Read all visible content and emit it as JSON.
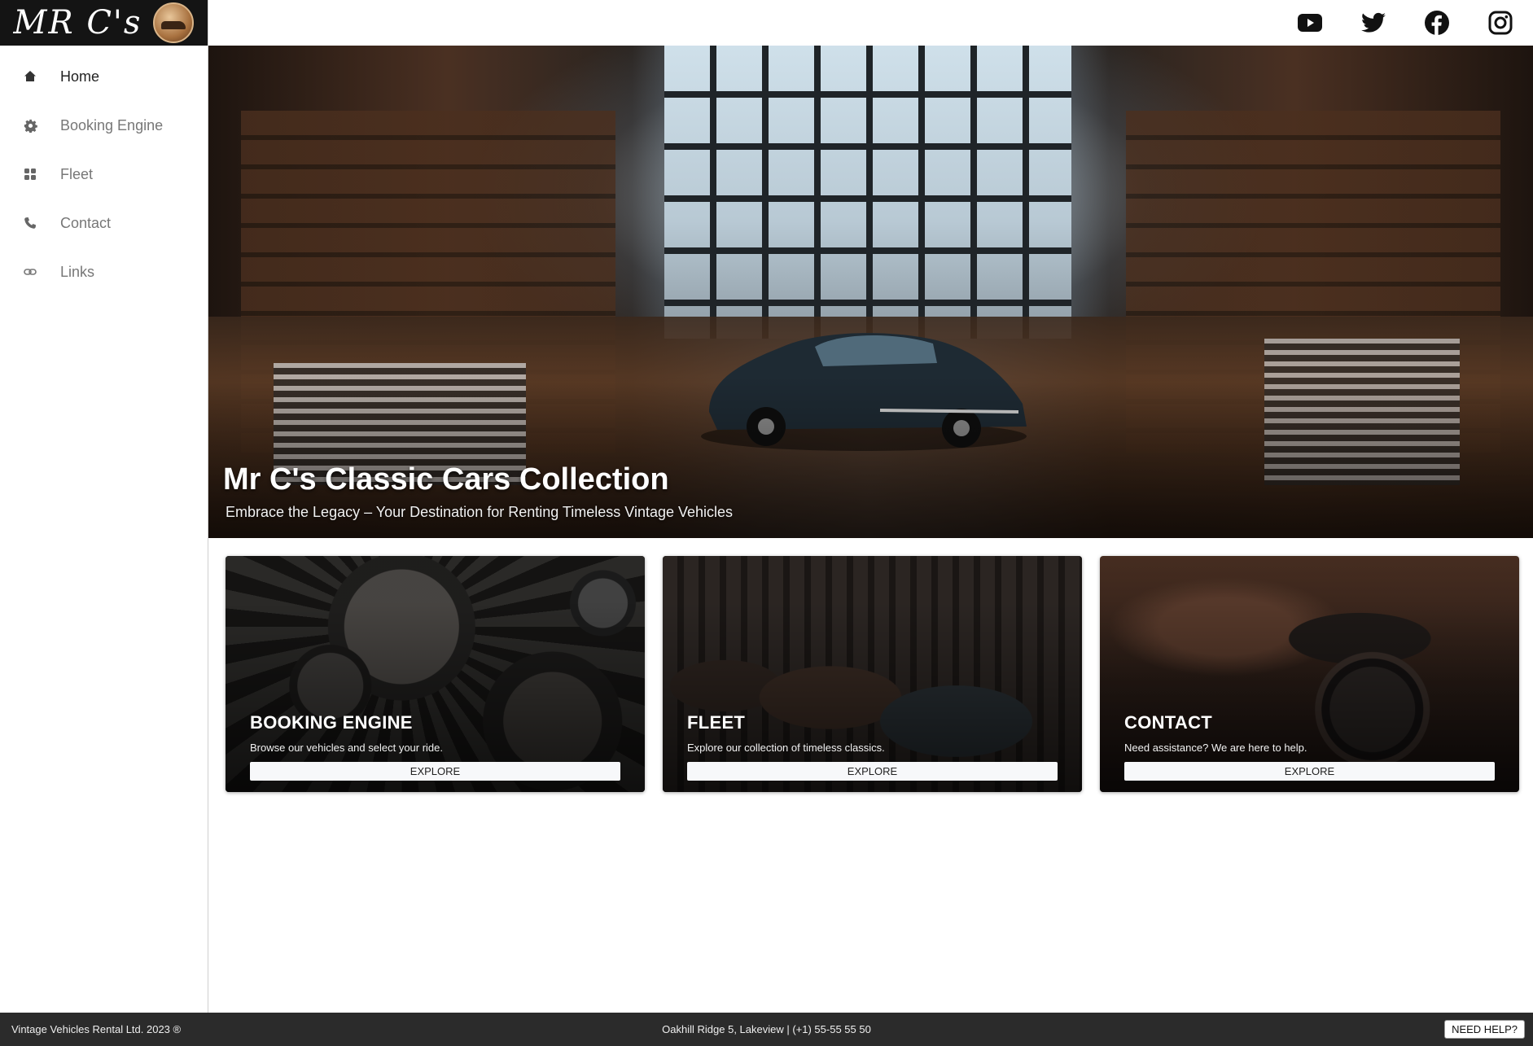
{
  "brand": {
    "logo_text": "MR C's"
  },
  "sidebar": {
    "items": [
      {
        "label": "Home",
        "icon": "home-icon",
        "active": true
      },
      {
        "label": "Booking Engine",
        "icon": "gear-icon",
        "active": false
      },
      {
        "label": "Fleet",
        "icon": "grid-icon",
        "active": false
      },
      {
        "label": "Contact",
        "icon": "phone-icon",
        "active": false
      },
      {
        "label": "Links",
        "icon": "link-icon",
        "active": false
      }
    ]
  },
  "topbar": {
    "social": [
      "youtube-icon",
      "twitter-icon",
      "facebook-icon",
      "instagram-icon"
    ]
  },
  "hero": {
    "title": "Mr C's Classic Cars Collection",
    "subtitle": "Embrace the Legacy – Your Destination for Renting Timeless Vintage Vehicles"
  },
  "cards": [
    {
      "title": "BOOKING ENGINE",
      "description": "Browse our vehicles and select your ride.",
      "button": "EXPLORE"
    },
    {
      "title": "FLEET",
      "description": "Explore our collection of timeless classics.",
      "button": "EXPLORE"
    },
    {
      "title": "CONTACT",
      "description": "Need assistance? We are here to help.",
      "button": "EXPLORE"
    }
  ],
  "footer": {
    "copyright": "Vintage Vehicles Rental Ltd. 2023 ®",
    "address": "Oakhill Ridge 5, Lakeview | (+1) 55-55 55 50",
    "help_button": "NEED HELP?"
  },
  "colors": {
    "sidebar_bg": "#ffffff",
    "logo_bg": "#141414",
    "footer_bg": "#2b2b2b",
    "card_button_bg": "#f7f8fa"
  }
}
